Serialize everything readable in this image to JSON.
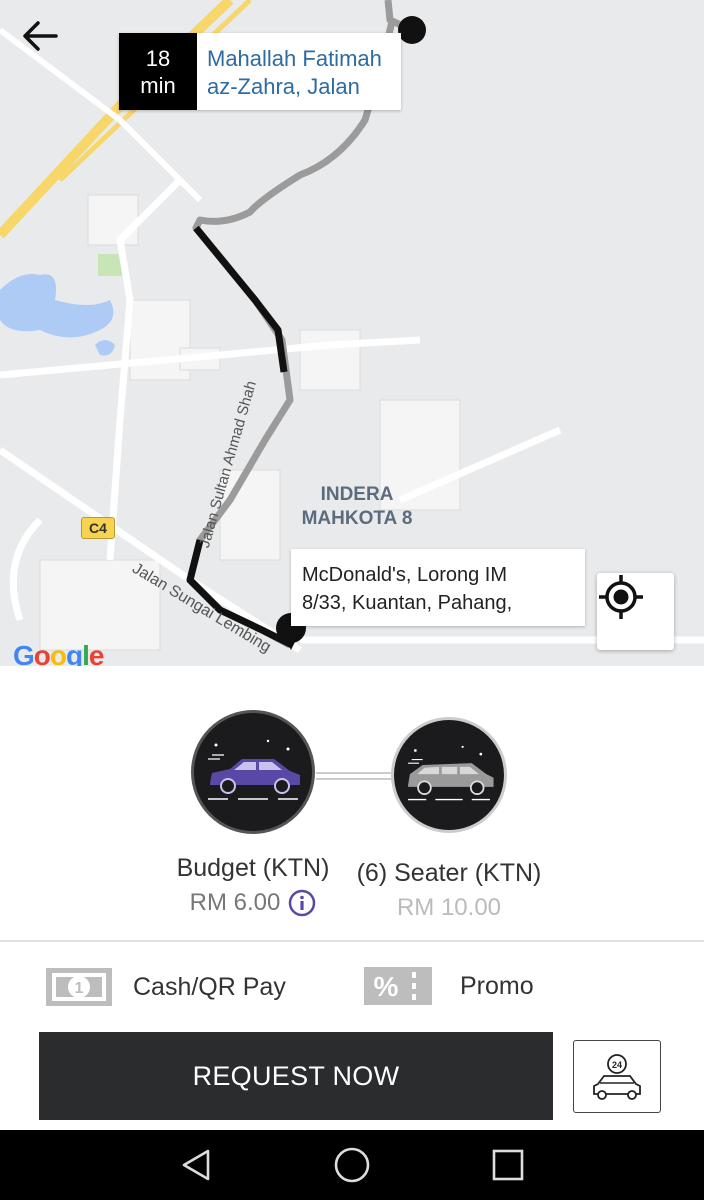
{
  "header": {
    "back_icon": "arrow-left-icon"
  },
  "eta": {
    "minutes": "18",
    "unit": "min",
    "destination_line1": "Mahallah Fatimah",
    "destination_line2": "az-Zahra, Jalan"
  },
  "pickup": {
    "line1": "McDonald's, Lorong IM",
    "line2": "8/33, Kuantan, Pahang,"
  },
  "map": {
    "area_label_line1": "INDERA",
    "area_label_line2": "MAHKOTA 8",
    "road_badge": "C4",
    "street_1": "Jalan Sungai Lembing",
    "street_2": "Jalan Sultan Ahmad Shah",
    "logo": "Google",
    "locate_icon": "crosshair-icon"
  },
  "vehicles": [
    {
      "name": "Budget (KTN)",
      "price": "RM 6.00",
      "selected": true,
      "color": "#5a48a6"
    },
    {
      "name": "(6) Seater (KTN)",
      "price": "RM 10.00",
      "selected": false,
      "color": "#9a9a9a"
    }
  ],
  "payment": {
    "method_label": "Cash/QR Pay",
    "method_icon": "cash-icon",
    "promo_label": "Promo",
    "promo_icon": "percent-tag-icon"
  },
  "actions": {
    "request_label": "REQUEST NOW",
    "schedule_icon": "car-24h-icon"
  },
  "system_nav": {
    "back": "nav-back-icon",
    "home": "nav-home-icon",
    "recents": "nav-recents-icon"
  },
  "colors": {
    "destination_text": "#2d6ba3",
    "info_icon": "#5a48a6",
    "request_button": "#2b2c2e"
  }
}
